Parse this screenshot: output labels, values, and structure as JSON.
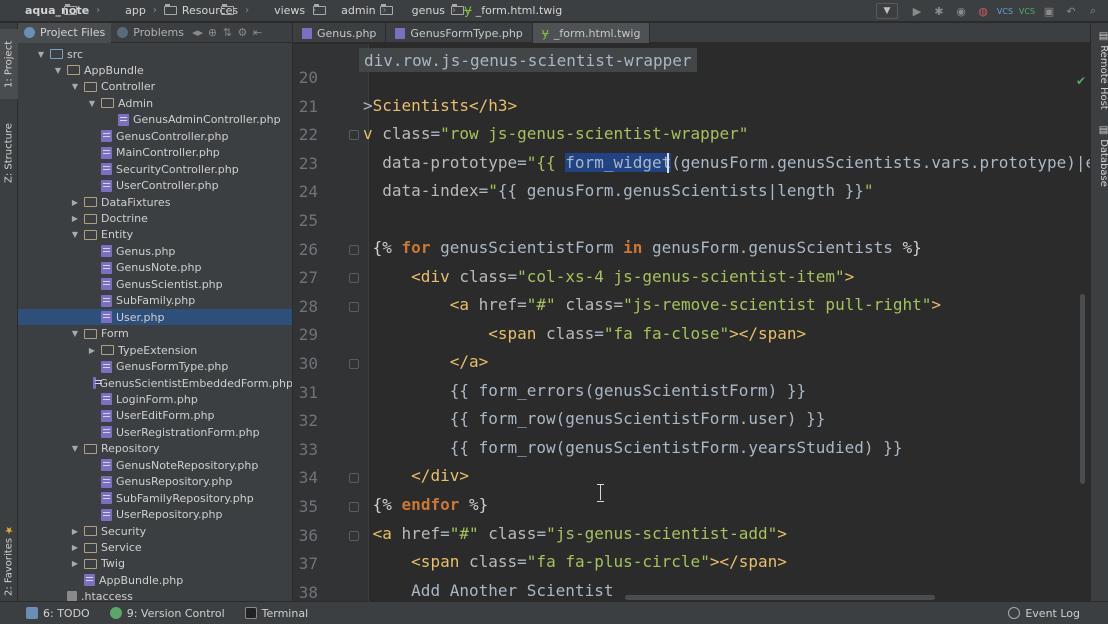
{
  "navbar": {
    "crumbs": [
      "aqua_note",
      "app",
      "Resources",
      "views",
      "admin",
      "genus",
      "_form.html.twig"
    ]
  },
  "left_strip": {
    "project_tab": "1: Project",
    "structure_tab": "Z: Structure",
    "favorites_tab": "2: Favorites"
  },
  "right_strip": {
    "remote_host_tab": "Remote Host",
    "database_tab": "Database"
  },
  "project_panel": {
    "tabs": [
      "Project Files",
      "Problems"
    ],
    "tree": [
      {
        "label": "src",
        "type": "folder",
        "depth": 0,
        "expanded": true
      },
      {
        "label": "AppBundle",
        "type": "folder",
        "depth": 1,
        "expanded": true
      },
      {
        "label": "Controller",
        "type": "folder",
        "depth": 2,
        "expanded": true
      },
      {
        "label": "Admin",
        "type": "folder",
        "depth": 3,
        "expanded": true
      },
      {
        "label": "GenusAdminController.php",
        "type": "php",
        "depth": 4
      },
      {
        "label": "GenusController.php",
        "type": "php",
        "depth": 3
      },
      {
        "label": "MainController.php",
        "type": "php",
        "depth": 3
      },
      {
        "label": "SecurityController.php",
        "type": "php",
        "depth": 3
      },
      {
        "label": "UserController.php",
        "type": "php",
        "depth": 3
      },
      {
        "label": "DataFixtures",
        "type": "folder",
        "depth": 2,
        "expanded": false
      },
      {
        "label": "Doctrine",
        "type": "folder",
        "depth": 2,
        "expanded": false
      },
      {
        "label": "Entity",
        "type": "folder",
        "depth": 2,
        "expanded": true
      },
      {
        "label": "Genus.php",
        "type": "php",
        "depth": 3
      },
      {
        "label": "GenusNote.php",
        "type": "php",
        "depth": 3
      },
      {
        "label": "GenusScientist.php",
        "type": "php",
        "depth": 3
      },
      {
        "label": "SubFamily.php",
        "type": "php",
        "depth": 3
      },
      {
        "label": "User.php",
        "type": "php",
        "depth": 3,
        "selected": true
      },
      {
        "label": "Form",
        "type": "folder",
        "depth": 2,
        "expanded": true
      },
      {
        "label": "TypeExtension",
        "type": "folder",
        "depth": 3,
        "expanded": false
      },
      {
        "label": "GenusFormType.php",
        "type": "php",
        "depth": 3
      },
      {
        "label": "GenusScientistEmbeddedForm.php",
        "type": "php",
        "depth": 3
      },
      {
        "label": "LoginForm.php",
        "type": "php",
        "depth": 3
      },
      {
        "label": "UserEditForm.php",
        "type": "php",
        "depth": 3
      },
      {
        "label": "UserRegistrationForm.php",
        "type": "php",
        "depth": 3
      },
      {
        "label": "Repository",
        "type": "folder",
        "depth": 2,
        "expanded": true
      },
      {
        "label": "GenusNoteRepository.php",
        "type": "php",
        "depth": 3
      },
      {
        "label": "GenusRepository.php",
        "type": "php",
        "depth": 3
      },
      {
        "label": "SubFamilyRepository.php",
        "type": "php",
        "depth": 3
      },
      {
        "label": "UserRepository.php",
        "type": "php",
        "depth": 3
      },
      {
        "label": "Security",
        "type": "folder",
        "depth": 2,
        "expanded": false
      },
      {
        "label": "Service",
        "type": "folder",
        "depth": 2,
        "expanded": false
      },
      {
        "label": "Twig",
        "type": "folder",
        "depth": 2,
        "expanded": false
      },
      {
        "label": "AppBundle.php",
        "type": "php",
        "depth": 2
      },
      {
        "label": ".htaccess",
        "type": "file",
        "depth": 1
      }
    ]
  },
  "editor_tabs": [
    {
      "label": "Genus.php",
      "type": "php"
    },
    {
      "label": "GenusFormType.php",
      "type": "php"
    },
    {
      "label": "_form.html.twig",
      "type": "twig",
      "active": true
    }
  ],
  "editor": {
    "breadcrumb": "div.row.js-genus-scientist-wrapper",
    "line_numbers": [
      "20",
      "21",
      "22",
      "23",
      "24",
      "25",
      "26",
      "27",
      "28",
      "29",
      "30",
      "31",
      "32",
      "33",
      "34",
      "35",
      "36",
      "37",
      "38"
    ]
  },
  "statusbar": {
    "todo": "6: TODO",
    "vcs": "9: Version Control",
    "terminal": "Terminal",
    "event_log": "Event Log"
  },
  "colors": {
    "selection": "#214283",
    "tag": "#e8bf6a",
    "string": "#a5c25c",
    "keyword": "#cc7832",
    "tree_selected": "#2d4f7a"
  }
}
